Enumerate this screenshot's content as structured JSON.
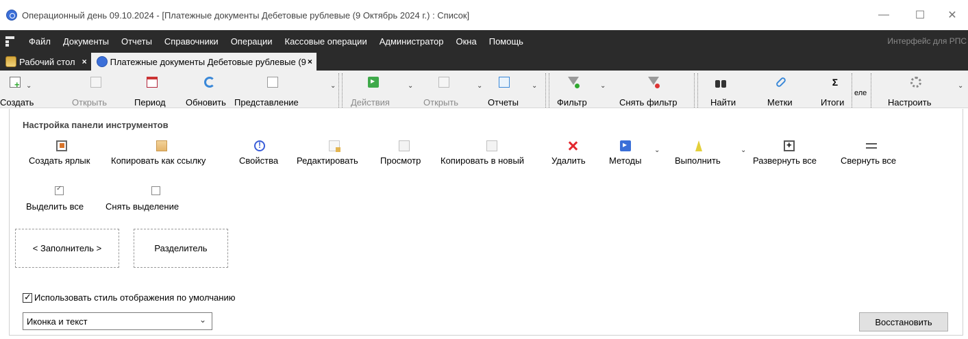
{
  "window": {
    "title": "Операционный день 09.10.2024 - [Платежные документы Дебетовые рублевые (9 Октябрь 2024 г.) : Список]",
    "minimize": "—",
    "maximize": "☐",
    "close": "✕"
  },
  "menu": {
    "items": [
      "Файл",
      "Документы",
      "Отчеты",
      "Справочники",
      "Операции",
      "Кассовые операции",
      "Администратор",
      "Окна",
      "Помощь"
    ],
    "right_text": "Интерфейс для РПС"
  },
  "tabs": [
    {
      "label": "Рабочий стол",
      "close": "×",
      "icon": "desktop-icon",
      "active": false
    },
    {
      "label": "Платежные документы Дебетовые рублевые (9",
      "close": "×",
      "icon": "document-app-icon",
      "active": true
    }
  ],
  "toolbar": {
    "create": "Создать",
    "open": "Открыть",
    "period": "Период",
    "refresh": "Обновить",
    "view": "Представление",
    "actions": "Действия",
    "open2": "Открыть",
    "reports": "Отчеты",
    "filter": "Фильтр",
    "clear_filter": "Снять фильтр",
    "find": "Найти",
    "marks": "Метки",
    "totals": "Итоги",
    "cut_label": "еле",
    "customize": "Настроить",
    "dropdown": "⌄"
  },
  "panel": {
    "title": "Настройка панели инструментов",
    "commands": {
      "create_shortcut": "Создать ярлык",
      "copy_as_link": "Копировать как ссылку",
      "properties": "Свойства",
      "edit": "Редактировать",
      "preview": "Просмотр",
      "copy_to_new": "Копировать в новый",
      "delete": "Удалить",
      "methods": "Методы",
      "execute": "Выполнить",
      "expand_all": "Развернуть все",
      "collapse_all": "Свернуть все",
      "select_all": "Выделить все",
      "deselect": "Снять выделение"
    },
    "filler": "< Заполнитель >",
    "separator": "Разделитель",
    "use_default_style_label": "Использовать стиль отображения по умолчанию",
    "use_default_style_checked": true,
    "display_style_value": "Иконка и текст",
    "restore_button": "Восстановить"
  },
  "colors": {
    "menubar_bg": "#2b2b2b",
    "toolbar_bg": "#f0f0f0",
    "accent_blue": "#3b6fd8",
    "delete_red": "#e3282e"
  }
}
